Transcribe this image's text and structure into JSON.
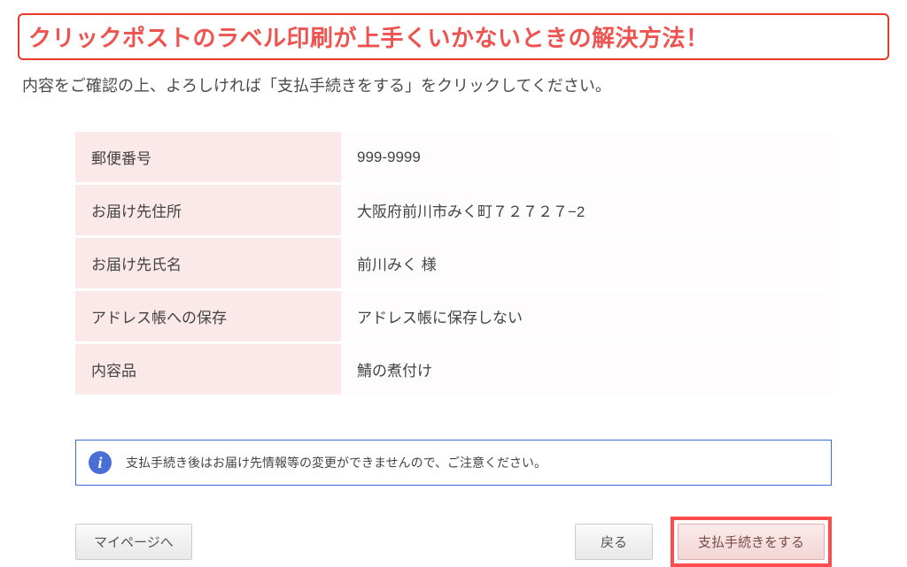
{
  "banner": {
    "title": "クリックポストのラベル印刷が上手くいかないときの解決方法！"
  },
  "instruction": "内容をご確認の上、よろしければ「支払手続きをする」をクリックしてください。",
  "table": {
    "rows": [
      {
        "label": "郵便番号",
        "value": "999-9999"
      },
      {
        "label": "お届け先住所",
        "value": "大阪府前川市みく町７２７２７−2"
      },
      {
        "label": "お届け先氏名",
        "value": "前川みく 様"
      },
      {
        "label": "アドレス帳への保存",
        "value": "アドレス帳に保存しない"
      },
      {
        "label": "内容品",
        "value": "鯖の煮付け"
      }
    ]
  },
  "notice": {
    "icon": "i",
    "text": "支払手続き後はお届け先情報等の変更ができませんので、ご注意ください。"
  },
  "buttons": {
    "mypage": "マイページへ",
    "back": "戻る",
    "submit": "支払手続きをする"
  }
}
